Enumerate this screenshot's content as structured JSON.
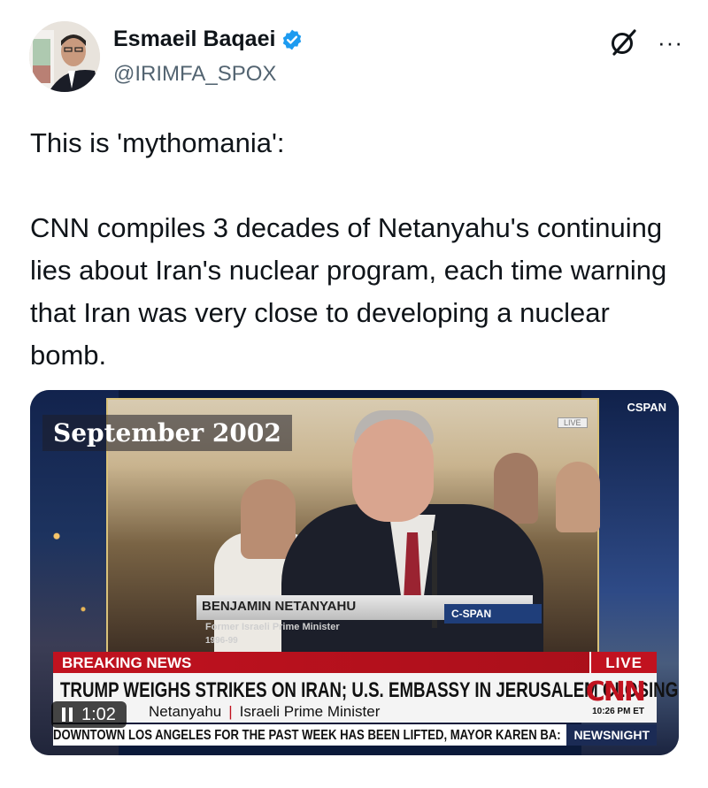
{
  "author": {
    "display_name": "Esmaeil Baqaei",
    "handle": "@IRIMFA_SPOX",
    "verified": true
  },
  "icons": {
    "verified": "verified-badge-icon",
    "grok": "grok-icon",
    "more": "more-options-icon",
    "pause": "pause-icon"
  },
  "more_label": "···",
  "tweet": {
    "paragraph1": "This is 'mythomania':",
    "paragraph2": "CNN compiles 3 decades of Netanyahu's continuing lies about Iran's nuclear program, each time warning that Iran was very close to developing a nuclear bomb."
  },
  "video": {
    "network_logo": "CSPAN",
    "live_small": "LIVE",
    "date_label": "September 2002",
    "lower_third": {
      "name": "BENJAMIN NETANYAHU",
      "channel": "C-SPAN",
      "title": "Former Israeli Prime Minister",
      "years": "1996-99"
    },
    "breaking_label": "BREAKING NEWS",
    "live_label": "LIVE",
    "headline": "TRUMP WEIGHS STRIKES ON IRAN; U.S. EMBASSY IN JERUSALEM CLOSING",
    "subline_name": "Netanyahu",
    "subline_sep": "|",
    "subline_title": "Israeli Prime Minister",
    "cnn_logo": "CNN",
    "time": "10:26 PM ET",
    "ticker": "DOWNTOWN LOS ANGELES FOR THE PAST WEEK HAS BEEN LIFTED, MAYOR KAREN BA:",
    "show_name": "NEWSNIGHT",
    "player_time": "1:02",
    "playing": true
  },
  "colors": {
    "verified_blue": "#1d9bf0",
    "cnn_red": "#c1121f",
    "handle_gray": "#536471"
  }
}
